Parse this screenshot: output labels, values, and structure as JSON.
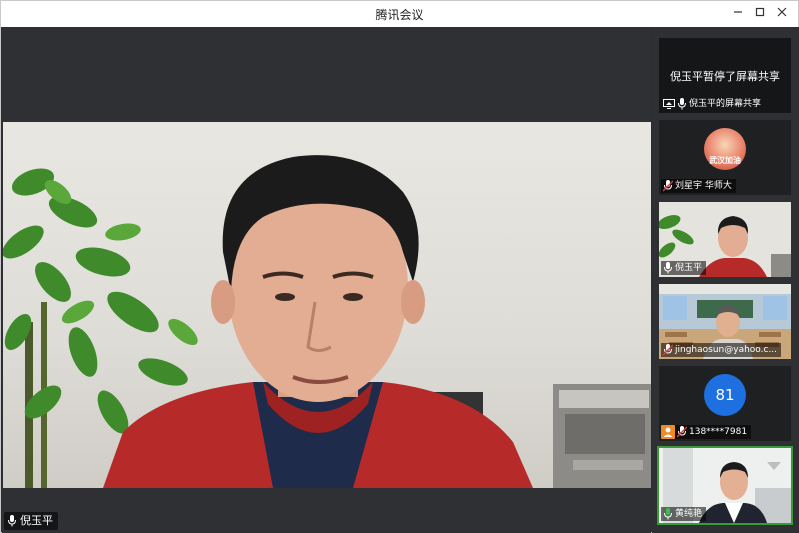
{
  "window": {
    "title": "腾讯会议",
    "min_icon": "minimize-icon",
    "max_icon": "maximize-icon",
    "close_icon": "close-icon"
  },
  "main_video": {
    "speaker_name": "倪玉平"
  },
  "sidebar": {
    "tiles": [
      {
        "type": "share",
        "message": "倪玉平暂停了屏幕共享",
        "label": "倪玉平的屏幕共享"
      },
      {
        "type": "avatar",
        "label": "刘星宇 华师大",
        "avatar_text": "武汉加油"
      },
      {
        "type": "video",
        "label": "倪玉平"
      },
      {
        "type": "video",
        "label": "jinghaosun@yahoo.c..."
      },
      {
        "type": "number",
        "label": "138****7981",
        "avatar_text": "81"
      },
      {
        "type": "video",
        "label": "黄纯艳"
      }
    ]
  },
  "colors": {
    "background": "#2e3033",
    "selected_border": "#3a9a3a",
    "number_avatar": "#1e6fe0",
    "phone_badge": "#f08a24"
  }
}
